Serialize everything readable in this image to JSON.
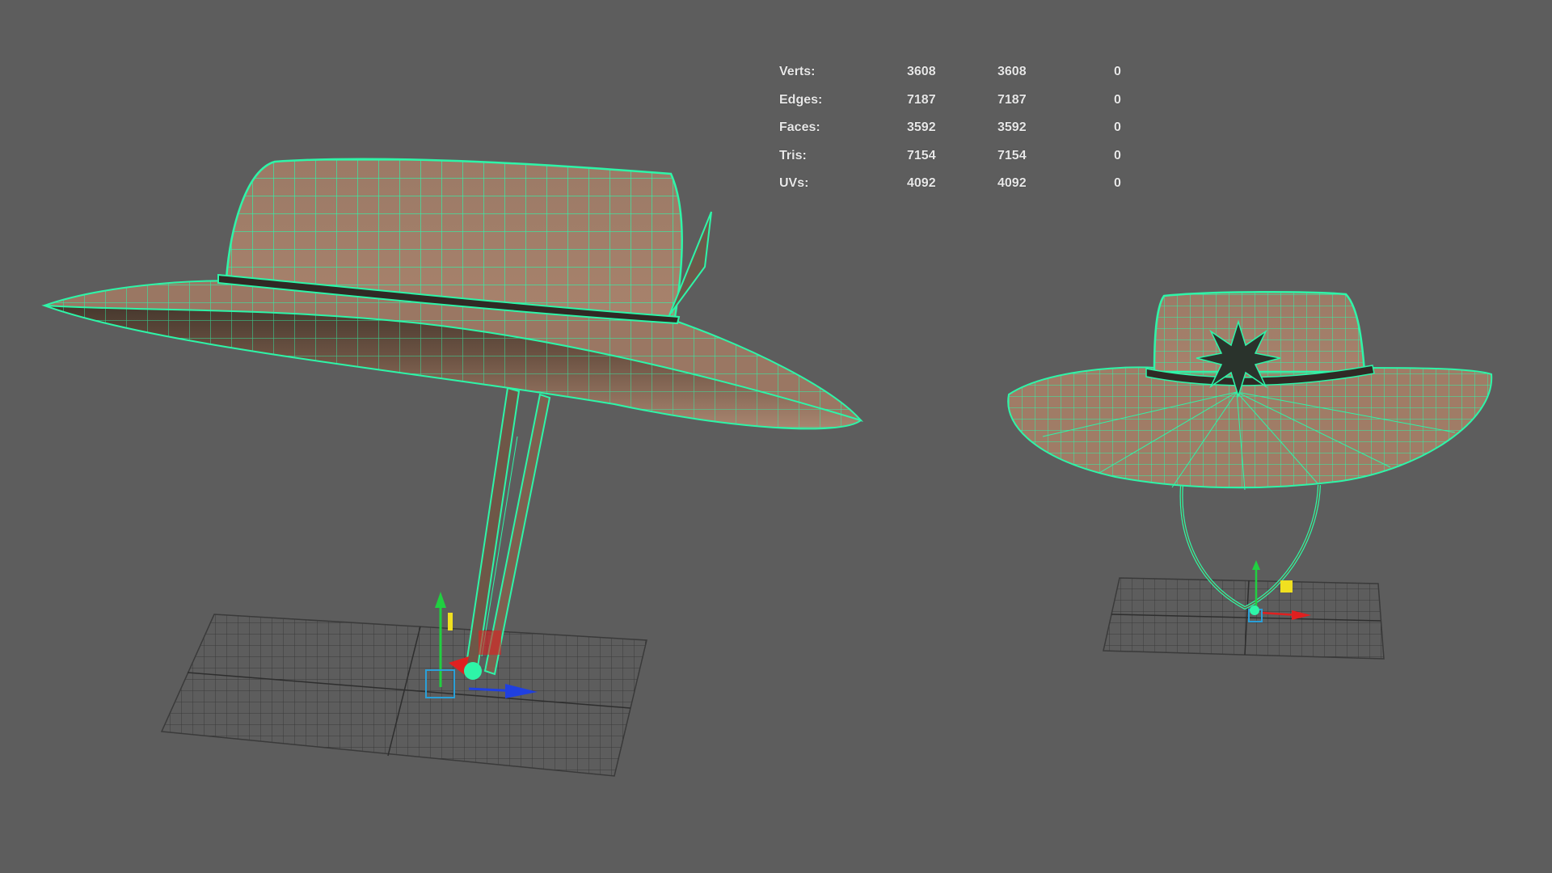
{
  "hud": {
    "rows": [
      {
        "label": "Verts:",
        "values": [
          "3608",
          "3608",
          "0"
        ]
      },
      {
        "label": "Edges:",
        "values": [
          "7187",
          "7187",
          "0"
        ]
      },
      {
        "label": "Faces:",
        "values": [
          "3592",
          "3592",
          "0"
        ]
      },
      {
        "label": "Tris:",
        "values": [
          "7154",
          "7154",
          "0"
        ]
      },
      {
        "label": "UVs:",
        "values": [
          "4092",
          "4092",
          "0"
        ]
      }
    ]
  },
  "colors": {
    "background": "#5d5d5d",
    "wireframe": "#2ef5a8",
    "hat_fabric": "#a07c66",
    "grid": "#3a3a3a",
    "axis_x": "#e02020",
    "axis_y": "#20d040",
    "axis_z": "#2040e0",
    "pivot": "#2aa0d8",
    "handle_yellow": "#f0e020"
  },
  "scene": {
    "objects": [
      {
        "name": "hat-perspective-view"
      },
      {
        "name": "hat-front-view"
      }
    ]
  }
}
